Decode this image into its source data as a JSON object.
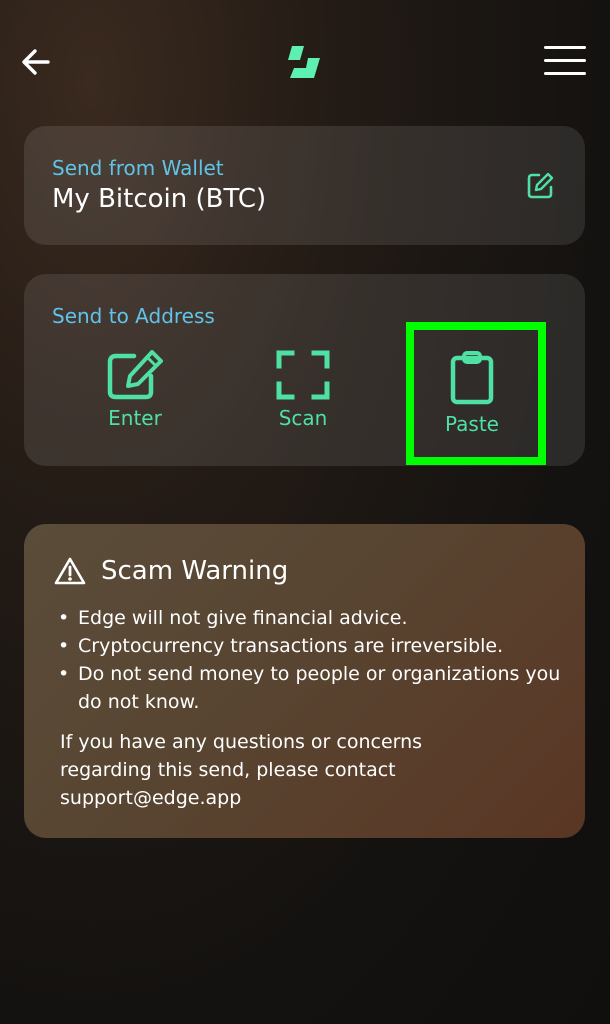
{
  "header": {
    "back_icon": "arrow-left-icon",
    "logo_icon": "edge-logo",
    "menu_icon": "hamburger-menu-icon"
  },
  "wallet": {
    "label": "Send from Wallet",
    "name": "My Bitcoin (BTC)",
    "edit_icon": "edit-icon"
  },
  "address": {
    "label": "Send to Address",
    "actions": [
      {
        "label": "Enter",
        "icon": "edit-icon"
      },
      {
        "label": "Scan",
        "icon": "scan-icon"
      },
      {
        "label": "Paste",
        "icon": "clipboard-icon"
      }
    ]
  },
  "warning": {
    "icon": "warning-triangle-icon",
    "title": "Scam Warning",
    "items": [
      "Edge will not give financial advice.",
      "Cryptocurrency transactions are irreversible.",
      "Do not send money to people or organizations you do not know."
    ],
    "note": "If you have any questions or concerns regarding this send, please contact support@edge.app"
  },
  "colors": {
    "accent_green": "#4fe0a3",
    "label_blue": "#5fc4e8",
    "highlight": "#00ff00"
  }
}
